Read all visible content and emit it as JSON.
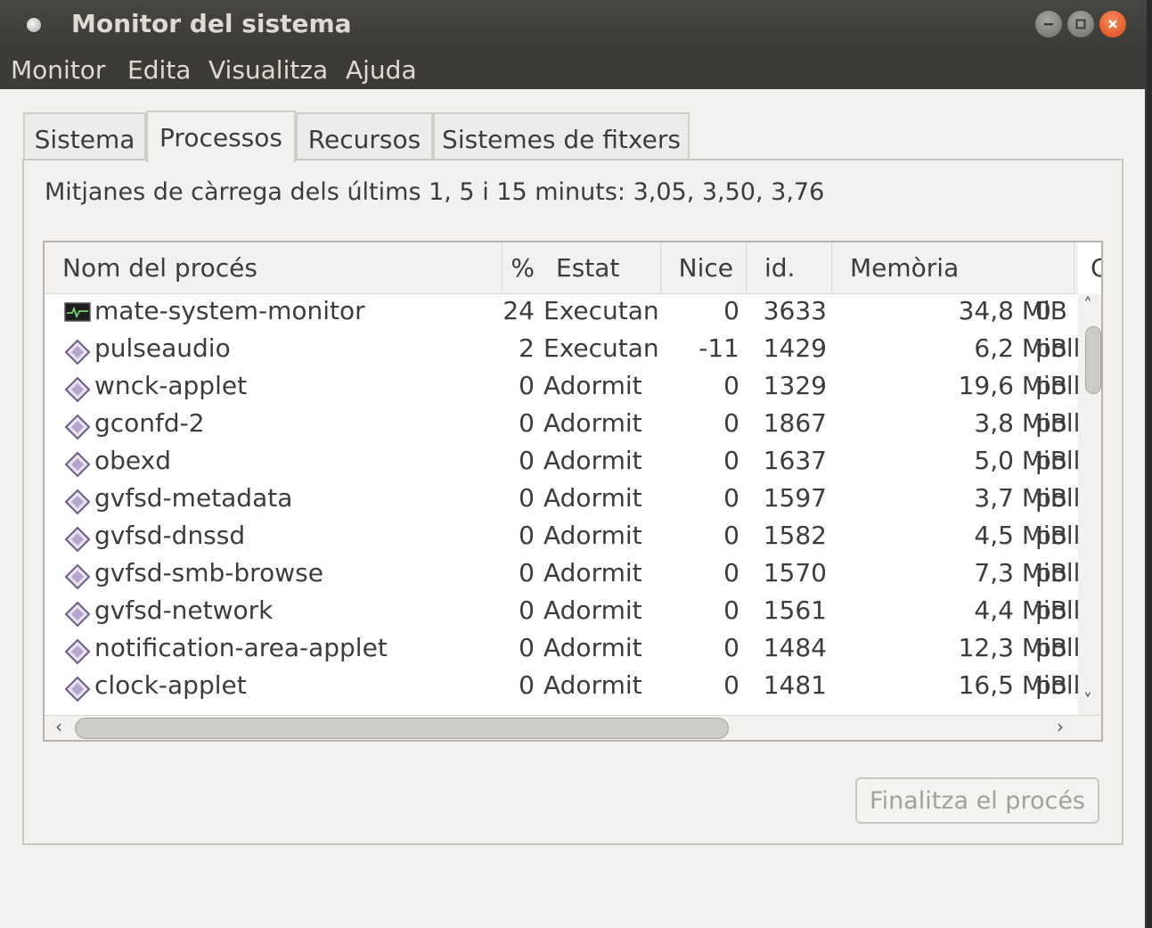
{
  "window": {
    "title": "Monitor del sistema"
  },
  "menu": [
    "Monitor",
    "Edita",
    "Visualitza",
    "Ajuda"
  ],
  "tabs": [
    "Sistema",
    "Processos",
    "Recursos",
    "Sistemes de fitxers"
  ],
  "active_tab": "Processos",
  "load_averages": "Mitjanes de càrrega dels últims 1, 5 i 15 minuts: 3,05, 3,50, 3,76",
  "columns": [
    "Nom del procés",
    "%",
    "Estat",
    "Nice",
    "id.",
    "Memòria",
    "Ca"
  ],
  "processes": [
    {
      "name": "mate-system-monitor",
      "cpu": "24",
      "state": "Executan",
      "nice": "0",
      "id": "3633",
      "mem": "34,8 MiB",
      "wchan": "0",
      "icon": "monitor-icon"
    },
    {
      "name": "pulseaudio",
      "cpu": "2",
      "state": "Executan",
      "nice": "-11",
      "id": "1429",
      "mem": "6,2 MiB",
      "wchan": "poll",
      "icon": "diamond-icon"
    },
    {
      "name": "wnck-applet",
      "cpu": "0",
      "state": "Adormit",
      "nice": "0",
      "id": "1329",
      "mem": "19,6 MiB",
      "wchan": "poll",
      "icon": "diamond-icon"
    },
    {
      "name": "gconfd-2",
      "cpu": "0",
      "state": "Adormit",
      "nice": "0",
      "id": "1867",
      "mem": "3,8 MiB",
      "wchan": "poll",
      "icon": "diamond-icon"
    },
    {
      "name": "obexd",
      "cpu": "0",
      "state": "Adormit",
      "nice": "0",
      "id": "1637",
      "mem": "5,0 MiB",
      "wchan": "poll",
      "icon": "diamond-icon"
    },
    {
      "name": "gvfsd-metadata",
      "cpu": "0",
      "state": "Adormit",
      "nice": "0",
      "id": "1597",
      "mem": "3,7 MiB",
      "wchan": "poll",
      "icon": "diamond-icon"
    },
    {
      "name": "gvfsd-dnssd",
      "cpu": "0",
      "state": "Adormit",
      "nice": "0",
      "id": "1582",
      "mem": "4,5 MiB",
      "wchan": "poll",
      "icon": "diamond-icon"
    },
    {
      "name": "gvfsd-smb-browse",
      "cpu": "0",
      "state": "Adormit",
      "nice": "0",
      "id": "1570",
      "mem": "7,3 MiB",
      "wchan": "poll",
      "icon": "diamond-icon"
    },
    {
      "name": "gvfsd-network",
      "cpu": "0",
      "state": "Adormit",
      "nice": "0",
      "id": "1561",
      "mem": "4,4 MiB",
      "wchan": "poll",
      "icon": "diamond-icon"
    },
    {
      "name": "notification-area-applet",
      "cpu": "0",
      "state": "Adormit",
      "nice": "0",
      "id": "1484",
      "mem": "12,3 MiB",
      "wchan": "poll",
      "icon": "diamond-icon"
    },
    {
      "name": "clock-applet",
      "cpu": "0",
      "state": "Adormit",
      "nice": "0",
      "id": "1481",
      "mem": "16,5 MiB",
      "wchan": "poll",
      "icon": "diamond-icon"
    }
  ],
  "end_process_button": "Finalitza el procés",
  "colors": {
    "titlebar": "#3c3b37",
    "title_text": "#dfdbd2",
    "close_button": "#e5541c",
    "window_bg": "#f2f1f0"
  }
}
